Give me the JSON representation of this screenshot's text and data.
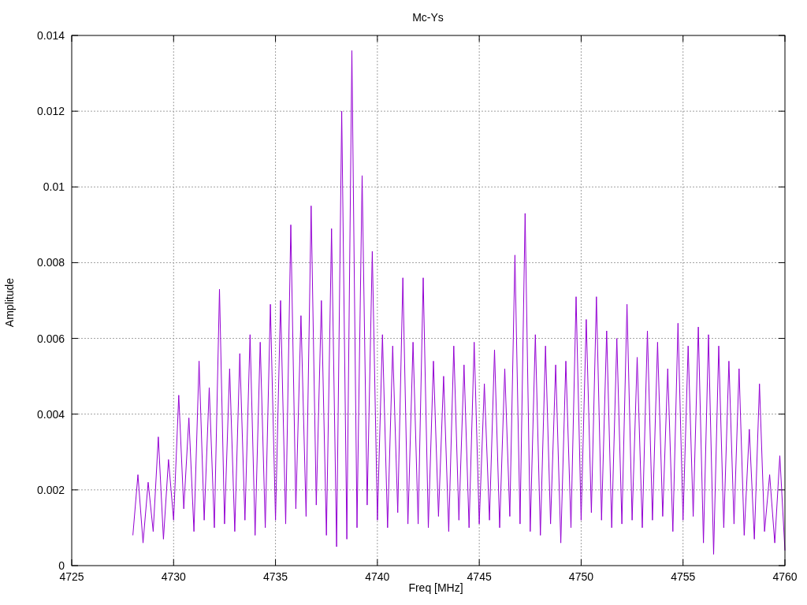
{
  "chart_data": {
    "type": "line",
    "grid": true,
    "title": "Mc-Ys",
    "xlabel": "Freq [MHz]",
    "ylabel": "Amplitude",
    "xlim": [
      4725,
      4760
    ],
    "ylim": [
      0,
      0.014
    ],
    "xticks": [
      4725,
      4730,
      4735,
      4740,
      4745,
      4750,
      4755,
      4760
    ],
    "yticks": [
      0,
      0.002,
      0.004,
      0.006,
      0.008,
      0.01,
      0.012,
      0.014
    ],
    "x": [
      4728,
      4728.25,
      4728.5,
      4728.75,
      4729,
      4729.25,
      4729.5,
      4729.75,
      4730,
      4730.25,
      4730.5,
      4730.75,
      4731,
      4731.25,
      4731.5,
      4731.75,
      4732,
      4732.25,
      4732.5,
      4732.75,
      4733,
      4733.25,
      4733.5,
      4733.75,
      4734,
      4734.25,
      4734.5,
      4734.75,
      4735,
      4735.25,
      4735.5,
      4735.75,
      4736,
      4736.25,
      4736.5,
      4736.75,
      4737,
      4737.25,
      4737.5,
      4737.75,
      4738,
      4738.25,
      4738.5,
      4738.75,
      4739,
      4739.25,
      4739.5,
      4739.75,
      4740,
      4740.25,
      4740.5,
      4740.75,
      4741,
      4741.25,
      4741.5,
      4741.75,
      4742,
      4742.25,
      4742.5,
      4742.75,
      4743,
      4743.25,
      4743.5,
      4743.75,
      4744,
      4744.25,
      4744.5,
      4744.75,
      4745,
      4745.25,
      4745.5,
      4745.75,
      4746,
      4746.25,
      4746.5,
      4746.75,
      4747,
      4747.25,
      4747.5,
      4747.75,
      4748,
      4748.25,
      4748.5,
      4748.75,
      4749,
      4749.25,
      4749.5,
      4749.75,
      4750,
      4750.25,
      4750.5,
      4750.75,
      4751,
      4751.25,
      4751.5,
      4751.75,
      4752,
      4752.25,
      4752.5,
      4752.75,
      4753,
      4753.25,
      4753.5,
      4753.75,
      4754,
      4754.25,
      4754.5,
      4754.75,
      4755,
      4755.25,
      4755.5,
      4755.75,
      4756,
      4756.25,
      4756.5,
      4756.75,
      4757,
      4757.25,
      4757.5,
      4757.75,
      4758,
      4758.25,
      4758.5,
      4758.75,
      4759,
      4759.25,
      4759.5,
      4759.75,
      4760
    ],
    "values": [
      0.0008,
      0.0024,
      0.0006,
      0.0022,
      0.0009,
      0.0034,
      0.0007,
      0.0028,
      0.0012,
      0.0045,
      0.0015,
      0.0039,
      0.0009,
      0.0054,
      0.0012,
      0.0047,
      0.001,
      0.0073,
      0.0011,
      0.0052,
      0.0009,
      0.0056,
      0.0012,
      0.0061,
      0.0008,
      0.0059,
      0.001,
      0.0069,
      0.0012,
      0.007,
      0.0011,
      0.009,
      0.0015,
      0.0066,
      0.0013,
      0.0095,
      0.0016,
      0.007,
      0.0008,
      0.0089,
      0.0005,
      0.012,
      0.0007,
      0.0136,
      0.001,
      0.0103,
      0.0016,
      0.0083,
      0.0012,
      0.0061,
      0.001,
      0.0058,
      0.0014,
      0.0076,
      0.0011,
      0.0059,
      0.0011,
      0.0076,
      0.001,
      0.0054,
      0.0013,
      0.005,
      0.0009,
      0.0058,
      0.0012,
      0.0053,
      0.001,
      0.0059,
      0.0011,
      0.0048,
      0.0012,
      0.0057,
      0.001,
      0.0052,
      0.0013,
      0.0082,
      0.0011,
      0.0093,
      0.0009,
      0.0061,
      0.0008,
      0.0058,
      0.0011,
      0.0053,
      0.0006,
      0.0054,
      0.001,
      0.0071,
      0.0012,
      0.0065,
      0.0014,
      0.0071,
      0.0012,
      0.0062,
      0.001,
      0.006,
      0.0011,
      0.0069,
      0.0012,
      0.0055,
      0.001,
      0.0062,
      0.0012,
      0.0059,
      0.0013,
      0.0052,
      0.0009,
      0.0064,
      0.0012,
      0.0058,
      0.0013,
      0.0063,
      0.0006,
      0.0061,
      0.0003,
      0.0058,
      0.001,
      0.0054,
      0.0011,
      0.0052,
      0.0008,
      0.0036,
      0.0007,
      0.0048,
      0.0009,
      0.0024,
      0.0006,
      0.0029,
      0.0004
    ]
  }
}
